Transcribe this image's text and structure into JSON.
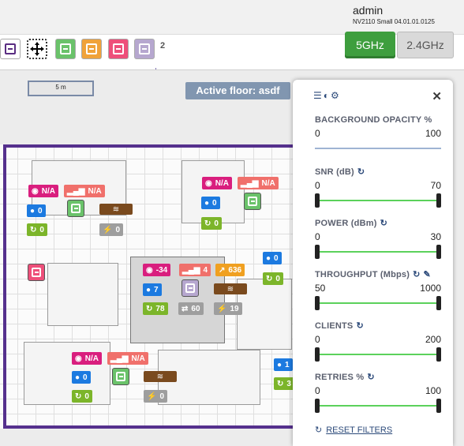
{
  "header": {
    "user": "admin",
    "device": "NV2110 Small 04.01.01.0125"
  },
  "toolbar": {
    "tools": [
      {
        "name": "tool-ap-purple",
        "color": "#5a2d82"
      },
      {
        "name": "tool-move",
        "color": "#000000"
      },
      {
        "name": "tool-ap-green",
        "color": "#6ac26a"
      },
      {
        "name": "tool-ap-orange",
        "color": "#f0a23a"
      },
      {
        "name": "tool-ap-pink",
        "color": "#ee4f7a"
      },
      {
        "name": "tool-ap-lavender",
        "color": "#b6a7cf"
      }
    ],
    "page": "2"
  },
  "bands": {
    "active": "5GHz",
    "inactive": "2.4GHz"
  },
  "map": {
    "scale": "5 m",
    "floor": "Active floor: asdf",
    "badges": [
      {
        "id": "b1",
        "text": "N/A",
        "cls": "b-pink",
        "icon": "rss-icon"
      },
      {
        "id": "b2",
        "text": "N/A",
        "cls": "b-salmon",
        "icon": "signal-bars-icon"
      },
      {
        "id": "b3",
        "text": "0",
        "cls": "b-blue",
        "icon": "user-icon"
      },
      {
        "id": "b4",
        "text": "0",
        "cls": "b-green",
        "icon": "refresh-icon"
      },
      {
        "id": "b5",
        "text": "N/A",
        "cls": "b-pink",
        "icon": "rss-icon"
      },
      {
        "id": "b6",
        "text": "N/A",
        "cls": "b-salmon",
        "icon": "signal-bars-icon"
      },
      {
        "id": "b7",
        "text": "0",
        "cls": "b-blue",
        "icon": "user-icon"
      },
      {
        "id": "b8",
        "text": "0",
        "cls": "b-green",
        "icon": "refresh-icon"
      },
      {
        "id": "b9",
        "text": "0",
        "cls": "b-gray",
        "icon": "bolt-icon"
      },
      {
        "id": "b10",
        "text": "-34",
        "cls": "b-pink",
        "icon": "rss-icon"
      },
      {
        "id": "b11",
        "text": "4",
        "cls": "b-salmon",
        "icon": "signal-bars-icon"
      },
      {
        "id": "b12",
        "text": "636",
        "cls": "b-orange",
        "icon": "trend-icon"
      },
      {
        "id": "b13",
        "text": "7",
        "cls": "b-blue",
        "icon": "user-icon"
      },
      {
        "id": "b14",
        "text": "78",
        "cls": "b-green",
        "icon": "refresh-icon"
      },
      {
        "id": "b15",
        "text": "60",
        "cls": "b-gray",
        "icon": "arrows-icon"
      },
      {
        "id": "b16",
        "text": "19",
        "cls": "b-gray",
        "icon": "bolt-icon"
      },
      {
        "id": "b17",
        "text": "0",
        "cls": "b-blue",
        "icon": "user-icon"
      },
      {
        "id": "b18",
        "text": "0",
        "cls": "b-green",
        "icon": "refresh-icon"
      },
      {
        "id": "b19",
        "text": "N/A",
        "cls": "b-pink",
        "icon": "rss-icon"
      },
      {
        "id": "b20",
        "text": "N/A",
        "cls": "b-salmon",
        "icon": "signal-bars-icon"
      },
      {
        "id": "b21",
        "text": "0",
        "cls": "b-blue",
        "icon": "user-icon"
      },
      {
        "id": "b22",
        "text": "0",
        "cls": "b-green",
        "icon": "refresh-icon"
      },
      {
        "id": "b23",
        "text": "0",
        "cls": "b-gray",
        "icon": "bolt-icon"
      },
      {
        "id": "b24",
        "text": "1",
        "cls": "b-blue",
        "icon": "user-icon"
      },
      {
        "id": "b25",
        "text": "3",
        "cls": "b-green",
        "icon": "refresh-icon"
      }
    ]
  },
  "panel": {
    "filters": [
      {
        "title": "BACKGROUND OPACITY %",
        "min": "0",
        "max": "100",
        "refresh": false
      },
      {
        "title": "SNR (dB)",
        "min": "0",
        "max": "70",
        "refresh": true
      },
      {
        "title": "POWER (dBm)",
        "min": "0",
        "max": "30",
        "refresh": true
      },
      {
        "title": "THROUGHPUT (Mbps)",
        "min": "50",
        "max": "1000",
        "refresh": true
      },
      {
        "title": "CLIENTS",
        "min": "0",
        "max": "200",
        "refresh": true
      },
      {
        "title": "RETRIES %",
        "min": "0",
        "max": "100",
        "refresh": true
      }
    ],
    "reset": "RESET FILTERS"
  }
}
